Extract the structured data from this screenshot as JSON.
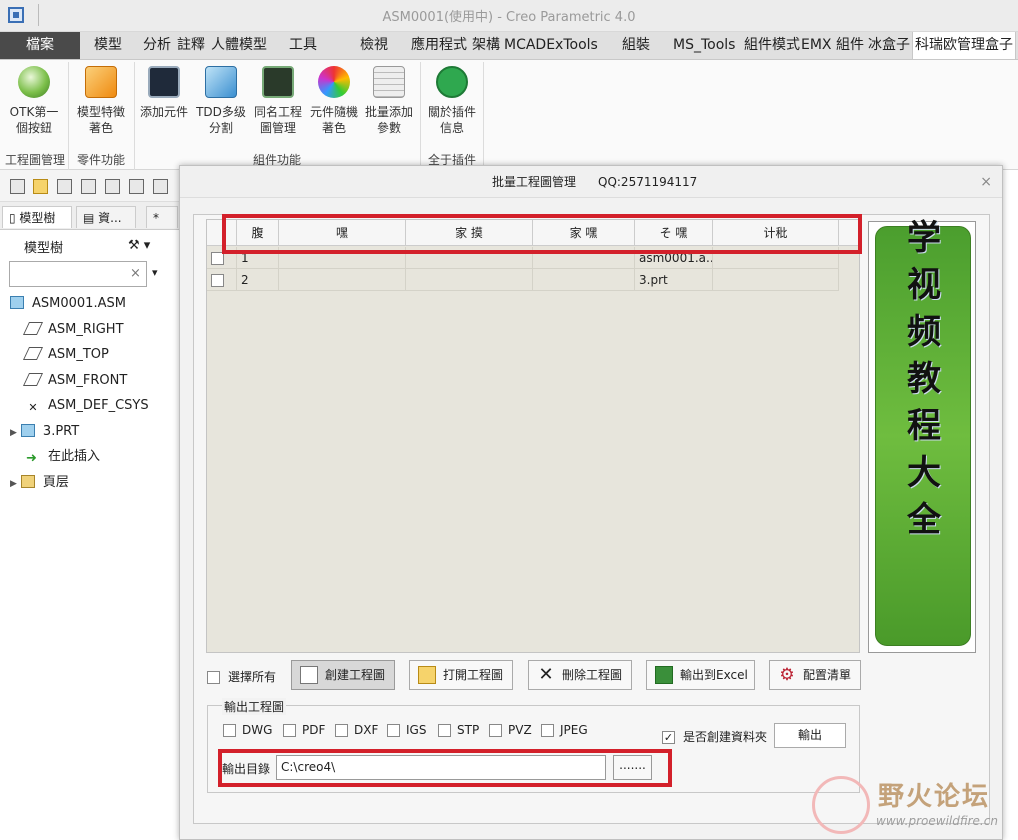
{
  "window": {
    "title": "ASM0001(使用中) - Creo Parametric 4.0"
  },
  "ribbon_tabs": [
    "檔案",
    "模型",
    "分析",
    "註釋",
    "人體模型",
    "工具",
    "檢視",
    "應用程式",
    "架構",
    "MCADExTools",
    "組裝",
    "MS_Tools",
    "組件模式",
    "EMX 組件",
    "冰盒子",
    "科瑞欧管理盒子"
  ],
  "ribbon": {
    "buttons": [
      {
        "label1": "OTK第一",
        "label2": "個按鈕"
      },
      {
        "label1": "模型特徵",
        "label2": "著色"
      },
      {
        "label1": "添加元件",
        "label2": ""
      },
      {
        "label1": "TDD多级",
        "label2": "分割"
      },
      {
        "label1": "同名工程",
        "label2": "圖管理"
      },
      {
        "label1": "元件隨機",
        "label2": "著色"
      },
      {
        "label1": "批量添加",
        "label2": "參數"
      },
      {
        "label1": "關於插件",
        "label2": "信息"
      }
    ],
    "groups": [
      "工程圖管理",
      "零件功能",
      "組件功能",
      "全于插件"
    ]
  },
  "left_panel": {
    "tabs": [
      "模型樹",
      "資...",
      "*"
    ],
    "header": "模型樹",
    "tree": [
      "ASM0001.ASM",
      "ASM_RIGHT",
      "ASM_TOP",
      "ASM_FRONT",
      "ASM_DEF_CSYS",
      "3.PRT",
      "在此插入",
      "頁层"
    ]
  },
  "dialog": {
    "title": "批量工程圖管理",
    "qq": "QQ:2571194117",
    "close": "×",
    "columns": [
      "腹",
      "嘿",
      "家 摸",
      "家 嘿",
      "そ 嘿",
      "计秕"
    ],
    "rows": [
      {
        "index": "1",
        "c2": "",
        "c3": "",
        "c4": "",
        "c5": "asm0001.a...",
        "c6": ""
      },
      {
        "index": "2",
        "c2": "",
        "c3": "",
        "c4": "",
        "c5": "3.prt",
        "c6": ""
      }
    ],
    "video_text": [
      "学",
      "视",
      "频",
      "教",
      "程",
      "大",
      "全"
    ],
    "select_all": "選擇所有",
    "buttons": {
      "create": "創建工程圖",
      "open": "打開工程圖",
      "delete": "刪除工程圖",
      "excel": "輸出到Excel",
      "config": "配置清單"
    },
    "output": {
      "group_label": "輸出工程圖",
      "formats": [
        "DWG",
        "PDF",
        "DXF",
        "IGS",
        "STP",
        "PVZ",
        "JPEG"
      ],
      "create_folder_label": "是否創建資料夾",
      "create_folder_checked": true,
      "export_button": "輸出",
      "dir_label": "輸出目錄",
      "dir_value": "C:\\creo4\\",
      "browse_button": "......."
    }
  },
  "watermark": {
    "text": "野火论坛",
    "url": "www.proewildfire.cn"
  },
  "colors": {
    "highlight_red": "#d3202a",
    "banner_green": "#5aab36",
    "file_tab": "#4a4a4a"
  }
}
